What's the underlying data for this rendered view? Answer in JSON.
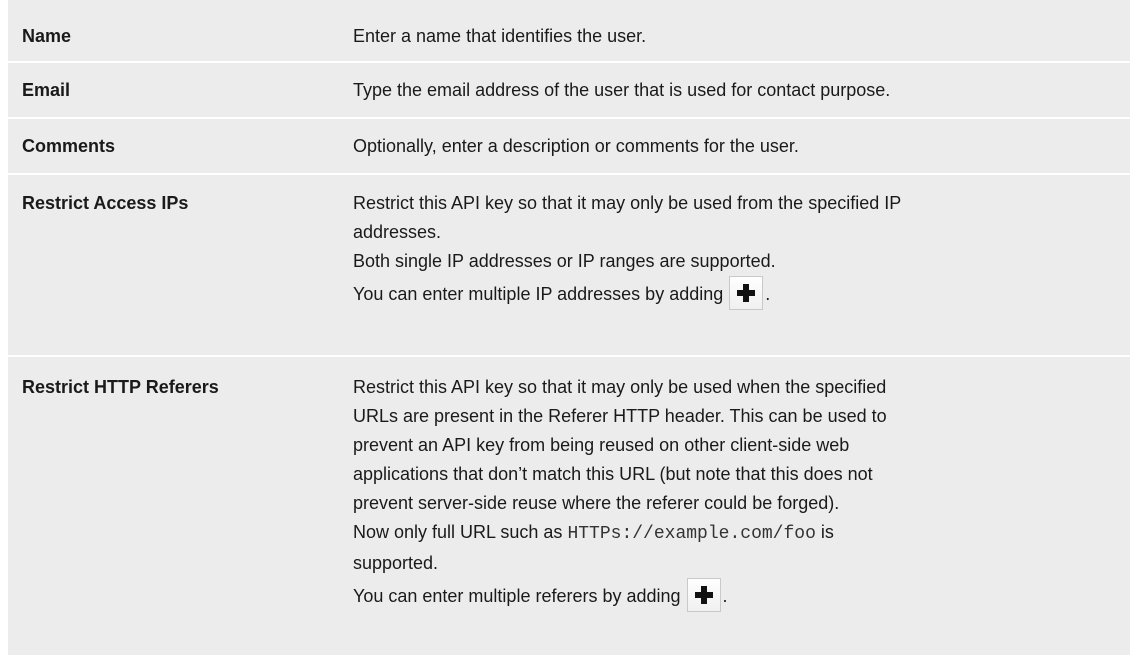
{
  "rows": [
    {
      "name": "Name",
      "lines": [
        "Enter a name that identifies the user."
      ]
    },
    {
      "name": "Email",
      "lines": [
        "Type the email address of the user that is used for contact purpose."
      ]
    },
    {
      "name": "Comments",
      "lines": [
        "Optionally, enter a description or comments for the user."
      ]
    },
    {
      "name": "Restrict Access IPs",
      "lines": [
        "Restrict this API key so that it may only be used from the specified IP",
        "addresses.",
        "Both single IP addresses or IP ranges are supported.",
        "You can enter multiple IP addresses by adding"
      ],
      "trailing": "."
    },
    {
      "name": "Restrict HTTP Referers",
      "lines": [
        "Restrict this API key so that it may only be used when the specified",
        "URLs are present in the Referer HTTP header. This can be used to",
        "prevent an API key from being reused on other client-side web",
        "applications that don’t match this URL (but note that this does not",
        "prevent server-side reuse where the referer could be forged).",
        "Now only full URL such as",
        "is",
        "supported.",
        "You can enter multiple referers by adding"
      ],
      "code": "HTTPs://example.com/foo",
      "trailing": "."
    }
  ],
  "icons": {
    "add": "plus-icon"
  }
}
